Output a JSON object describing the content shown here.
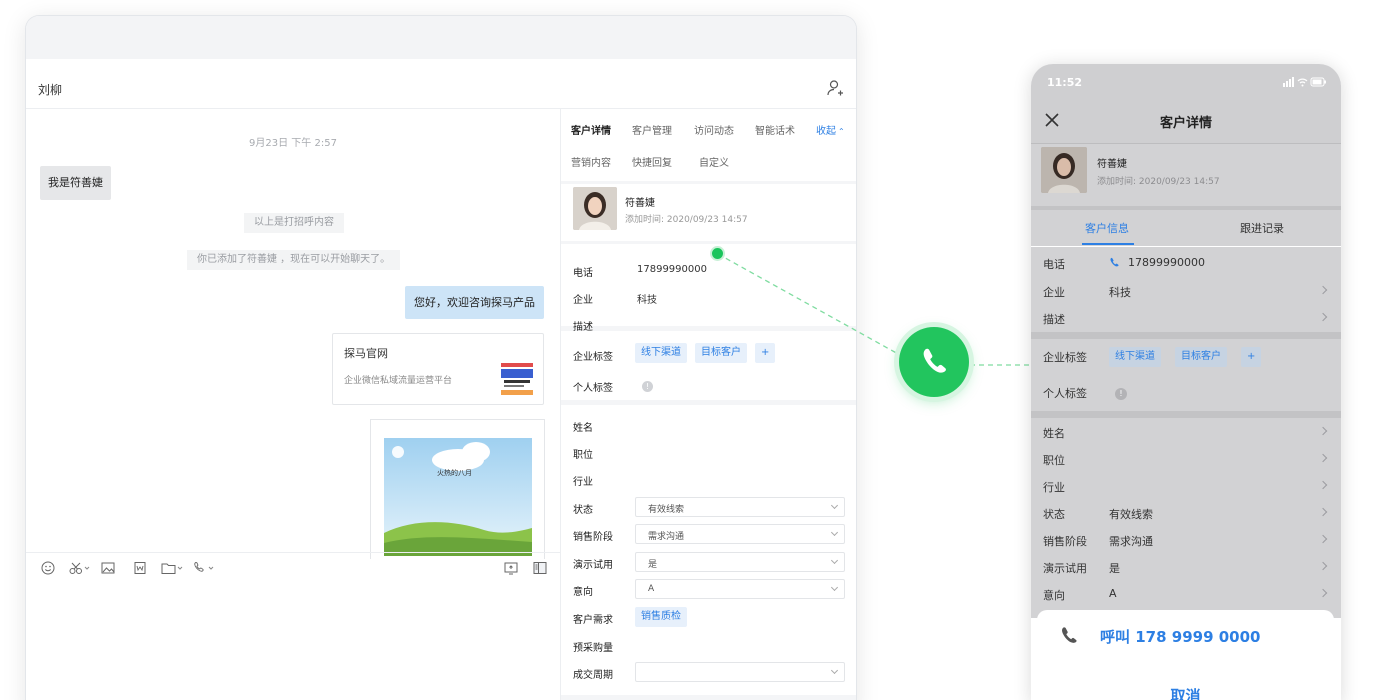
{
  "desktop": {
    "chat_title": "刘柳",
    "timestamp": "9月23日 下午 2:57",
    "incoming_msg": "我是符善婕",
    "system_greeting": "以上是打招呼内容",
    "system_added": "你已添加了符善婕 ，现在可以开始聊天了。",
    "outgoing_msg": "您好，欢迎咨询探马产品",
    "link_card": {
      "title": "探马官网",
      "desc": "企业微信私域流量运营平台"
    },
    "image_card_text": "火热的八月"
  },
  "panel": {
    "tabs_row1": [
      "客户详情",
      "客户管理",
      "访问动态",
      "智能话术"
    ],
    "collapse_label": "收起",
    "tabs_row2": [
      "营销内容",
      "快捷回复",
      "自定义"
    ],
    "profile": {
      "name": "符善婕",
      "added": "添加时间: 2020/09/23 14:57"
    },
    "phone_label": "电话",
    "phone_value": "17899990000",
    "company_label": "企业",
    "company_value": "科技",
    "desc_label": "描述",
    "company_tags_label": "企业标签",
    "company_tags": [
      "线下渠道",
      "目标客户"
    ],
    "add_tag": "+",
    "personal_tags_label": "个人标签",
    "info_mark": "!",
    "fields": {
      "name": "姓名",
      "position": "职位",
      "industry": "行业",
      "status": "状态",
      "status_value": "有效线索",
      "stage": "销售阶段",
      "stage_value": "需求沟通",
      "demo": "演示试用",
      "demo_value": "是",
      "intent": "意向",
      "intent_value": "A",
      "demand": "客户需求",
      "demand_tag": "销售质检",
      "purchase": "预采购量",
      "cycle": "成交周期"
    }
  },
  "phone": {
    "time": "11:52",
    "title": "客户详情",
    "name": "符善婕",
    "added": "添加时间: 2020/09/23 14:57",
    "tab_info": "客户信息",
    "tab_follow": "跟进记录",
    "phone_label": "电话",
    "phone_value": "17899990000",
    "company_label": "企业",
    "company_value": "科技",
    "desc_label": "描述",
    "company_tags_label": "企业标签",
    "company_tags": [
      "线下渠道",
      "目标客户"
    ],
    "add_tag": "+",
    "personal_tags_label": "个人标签",
    "info_mark": "!",
    "name_label": "姓名",
    "position_label": "职位",
    "industry_label": "行业",
    "status_label": "状态",
    "status_value": "有效线索",
    "stage_label": "销售阶段",
    "stage_value": "需求沟通",
    "demo_label": "演示试用",
    "demo_value": "是",
    "intent_label": "意向",
    "intent_value": "A",
    "call_action": "呼叫 178 9999 0000",
    "cancel": "取消"
  },
  "colors": {
    "accent": "#2d7fe3",
    "call_green": "#22c55e"
  }
}
